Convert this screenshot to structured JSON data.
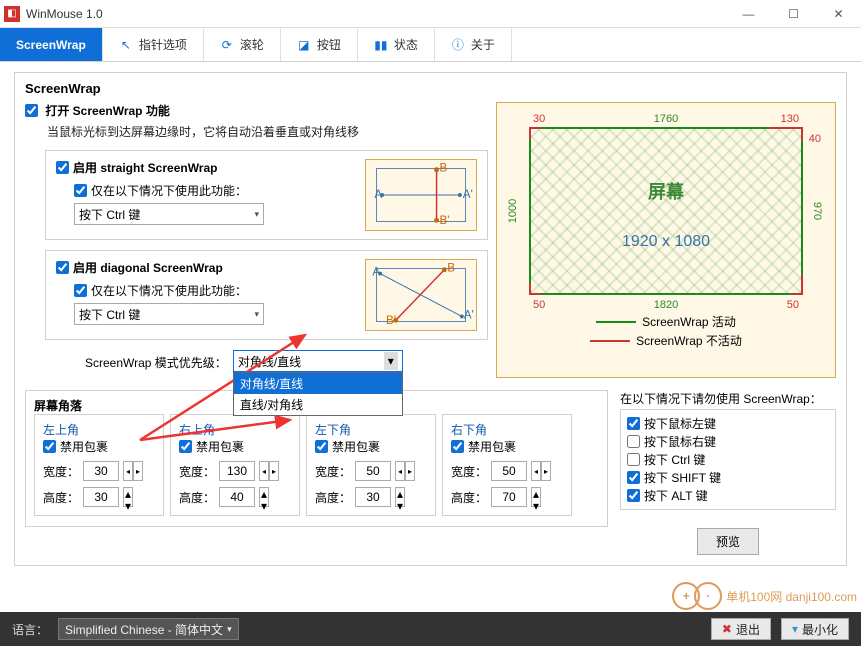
{
  "window": {
    "title": "WinMouse 1.0"
  },
  "tabs": [
    "ScreenWrap",
    "指针选项",
    "滚轮",
    "按钮",
    "状态",
    "关于"
  ],
  "main": {
    "group_title": "ScreenWrap",
    "enable_label": "打开 ScreenWrap 功能",
    "desc": "当鼠标光标到达屏幕边缘时，它将自动沿着垂直或对角线移",
    "straight": {
      "enable": "启用 straight ScreenWrap",
      "only_when": "仅在以下情况下使用此功能：",
      "combo": "按下 Ctrl 键"
    },
    "diagonal": {
      "enable": "启用 diagonal ScreenWrap",
      "only_when": "仅在以下情况下使用此功能：",
      "combo": "按下 Ctrl 键"
    },
    "priority_label": "ScreenWrap 模式优先级：",
    "priority_sel": "对角线/直线",
    "priority_options": [
      "对角线/直线",
      "直线/对角线"
    ]
  },
  "preview": {
    "top_left": "30",
    "top_center": "1760",
    "top_right": "130",
    "left": "1000",
    "right_top": "40",
    "right": "970",
    "bot_left": "50",
    "bot_center": "1820",
    "bot_right": "50",
    "screen_label": "屏幕",
    "resolution": "1920 x 1080",
    "legend_active": "ScreenWrap 活动",
    "legend_inactive": "ScreenWrap 不活动"
  },
  "avoid": {
    "title": "在以下情况下请勿使用 ScreenWrap：",
    "items": [
      {
        "label": "按下鼠标左键",
        "checked": true
      },
      {
        "label": "按下鼠标右键",
        "checked": false
      },
      {
        "label": "按下 Ctrl 键",
        "checked": false
      },
      {
        "label": "按下 SHIFT 键",
        "checked": true
      },
      {
        "label": "按下 ALT 键",
        "checked": true
      }
    ],
    "preview_btn": "预览"
  },
  "corners": {
    "group": "屏幕角落",
    "disable": "禁用包裹",
    "width": "宽度：",
    "height": "高度：",
    "items": [
      {
        "name": "左上角",
        "w": "30",
        "h": "30"
      },
      {
        "name": "右上角",
        "w": "130",
        "h": "40"
      },
      {
        "name": "左下角",
        "w": "50",
        "h": "30"
      },
      {
        "name": "右下角",
        "w": "50",
        "h": "70"
      }
    ]
  },
  "bottom": {
    "lang_label": "语言：",
    "lang_value": "Simplified Chinese  -  简体中文",
    "exit": "退出",
    "minimize": "最小化"
  },
  "watermark": "单机100网 danji100.com"
}
